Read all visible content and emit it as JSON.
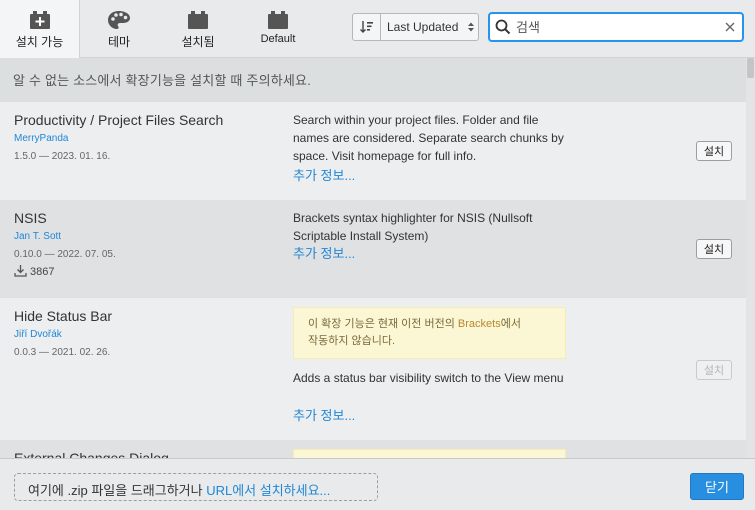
{
  "tabs": [
    {
      "label": "설치 가능",
      "icon": "extension-add-icon"
    },
    {
      "label": "테마",
      "icon": "palette-icon"
    },
    {
      "label": "설치됨",
      "icon": "extension-icon"
    },
    {
      "label": "Default",
      "icon": "extension-icon"
    }
  ],
  "sort": {
    "label": "Last Updated",
    "icon": "sort-icon"
  },
  "search": {
    "placeholder": "검색",
    "value": ""
  },
  "warning": "알 수 없는 소스에서 확장기능을 설치할 때 주의하세요.",
  "extensions": [
    {
      "title": "Productivity / Project Files Search",
      "author": "MerryPanda",
      "meta": "1.5.0 — 2023. 01. 16.",
      "description": "Search within your project files. Folder and file names are considered. Separate search chunks by space. Visit homepage for full info.",
      "more": "추가 정보...",
      "install": "설치"
    },
    {
      "title": "NSIS",
      "author": "Jan T. Sott",
      "meta": "0.10.0 — 2022. 07. 05.",
      "downloads": "3867",
      "description": "Brackets syntax highlighter for NSIS (Nullsoft Scriptable Install System)",
      "more": "추가 정보...",
      "install": "설치"
    },
    {
      "title": "Hide Status Bar",
      "author": "Jiří Dvořák",
      "meta": "0.0.3 — 2021. 02. 26.",
      "compat_pre": "이 확장 기능은 현재 이전 버전의 ",
      "compat_hl": "Brackets",
      "compat_post": "에서",
      "compat_line2": "작동하지 않습니다.",
      "description": "Adds a status bar visibility switch to the View menu",
      "more": "추가 정보...",
      "install": "설치"
    },
    {
      "title": "External Changes Dialog"
    }
  ],
  "footer": {
    "drop_pre": "여기에 .zip 파일을 드래그하거나 ",
    "drop_link": "URL에서 설치하세요...",
    "close": "닫기"
  },
  "colors": {
    "accent": "#2893ef",
    "link": "#2187d6",
    "warning_bg": "#fbf6d3"
  }
}
